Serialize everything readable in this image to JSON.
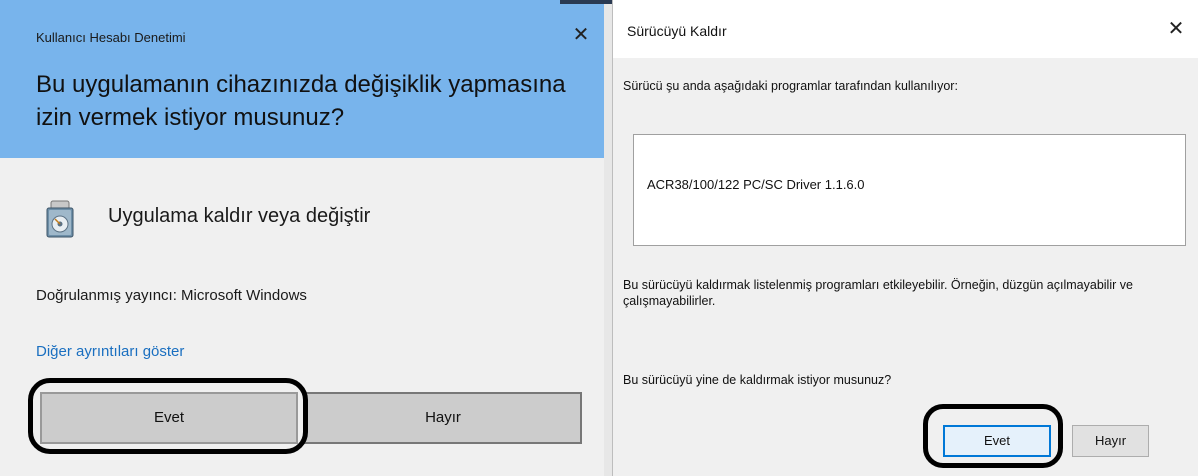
{
  "uac": {
    "window_title": "Kullanıcı Hesabı Denetimi",
    "close_glyph": "✕",
    "question": "Bu uygulamanın cihazınızda değişiklik yapmasına izin vermek istiyor musunuz?",
    "app_icon": "installer-disc-icon",
    "app_name": "Uygulama kaldır veya değiştir",
    "publisher": "Doğrulanmış yayıncı: Microsoft Windows",
    "details_link": "Diğer ayrıntıları göster",
    "yes_label": "Evet",
    "no_label": "Hayır",
    "header_color": "#78b4ec",
    "link_color": "#1a6fc0"
  },
  "uninstall": {
    "window_title": "Sürücüyü Kaldır",
    "close_glyph": "✕",
    "in_use_text": "Sürücü şu anda aşağıdaki programlar tarafından kullanılıyor:",
    "programs": [
      "ACR38/100/122 PC/SC Driver 1.1.6.0"
    ],
    "warning_text": "Bu sürücüyü kaldırmak listelenmiş programları etkileyebilir. Örneğin, düzgün açılmayabilir ve çalışmayabilirler.",
    "confirm_text": "Bu sürücüyü yine de kaldırmak istiyor musunuz?",
    "yes_label": "Evet",
    "no_label": "Hayır",
    "focus_color": "#0078d7"
  }
}
